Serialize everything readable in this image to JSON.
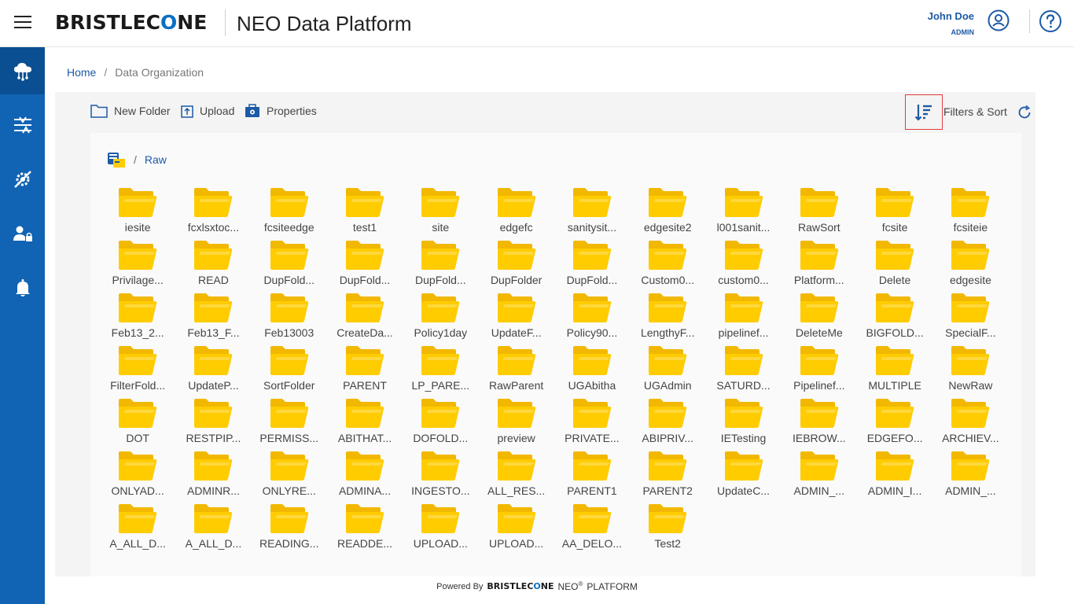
{
  "header": {
    "brand_pre": "BRISTLEC",
    "brand_o": "O",
    "brand_post": "NE",
    "app_title": "NEO Data Platform",
    "user_name": "John Doe",
    "user_role": "ADMIN",
    "icons": [
      "menu-icon",
      "user-circle-icon",
      "help-circle-icon"
    ]
  },
  "sidebar": {
    "items": [
      {
        "icon": "cloud-network-icon",
        "active": true
      },
      {
        "icon": "pipeline-icon",
        "active": false
      },
      {
        "icon": "settings-tools-icon",
        "active": false
      },
      {
        "icon": "user-admin-icon",
        "active": false
      },
      {
        "icon": "bell-icon",
        "active": false
      }
    ]
  },
  "breadcrumb": {
    "home": "Home",
    "separator": "/",
    "current": "Data Organization"
  },
  "toolbar": {
    "new_folder": "New Folder",
    "upload": "Upload",
    "properties": "Properties",
    "filters_sort": "Filters & Sort"
  },
  "path": {
    "separator": "/",
    "current": "Raw"
  },
  "folders": [
    "iesite",
    "fcxlsxtoc...",
    "fcsiteedge",
    "test1",
    "site",
    "edgefc",
    "sanitysit...",
    "edgesite2",
    "l001sanit...",
    "RawSort",
    "fcsite",
    "fcsiteie",
    "Privilage...",
    "READ",
    "DupFold...",
    "DupFold...",
    "DupFold...",
    "DupFolder",
    "DupFold...",
    "Custom0...",
    "custom0...",
    "Platform...",
    "Delete",
    "edgesite",
    "Feb13_2...",
    "Feb13_F...",
    "Feb13003",
    "CreateDa...",
    "Policy1day",
    "UpdateF...",
    "Policy90...",
    "LengthyF...",
    "pipelinef...",
    "DeleteMe",
    "BIGFOLD...",
    "SpecialF...",
    "FilterFold...",
    "UpdateP...",
    "SortFolder",
    "PARENT",
    "LP_PARE...",
    "RawParent",
    "UGAbitha",
    "UGAdmin",
    "SATURD...",
    "Pipelinef...",
    "MULTIPLE",
    "NewRaw",
    "DOT",
    "RESTPIP...",
    "PERMISS...",
    "ABITHAT...",
    "DOFOLD...",
    "preview",
    "PRIVATE...",
    "ABIPRIV...",
    "IETesting",
    "IEBROW...",
    "EDGEFO...",
    "ARCHIEV...",
    "ONLYAD...",
    "ADMINR...",
    "ONLYRE...",
    "ADMINA...",
    "INGESTO...",
    "ALL_RES...",
    "PARENT1",
    "PARENT2",
    "UpdateC...",
    "ADMIN_...",
    "ADMIN_I...",
    "ADMIN_...",
    "A_ALL_D...",
    "A_ALL_D...",
    "READING...",
    "READDE...",
    "UPLOAD...",
    "UPLOAD...",
    "AA_DELO...",
    "Test2"
  ],
  "footer": {
    "powered_by": "Powered By",
    "brand_pre": "BRISTLEC",
    "brand_o": "O",
    "brand_post": "NE",
    "neo": "NEO",
    "reg": "®",
    "platform": "PLATFORM"
  },
  "colors": {
    "sidebar": "#1163b3",
    "sidebar_active": "#0b4f93",
    "accent": "#1d5aa6",
    "folder": "#ffcc00",
    "filter_border": "#e23a3a"
  }
}
